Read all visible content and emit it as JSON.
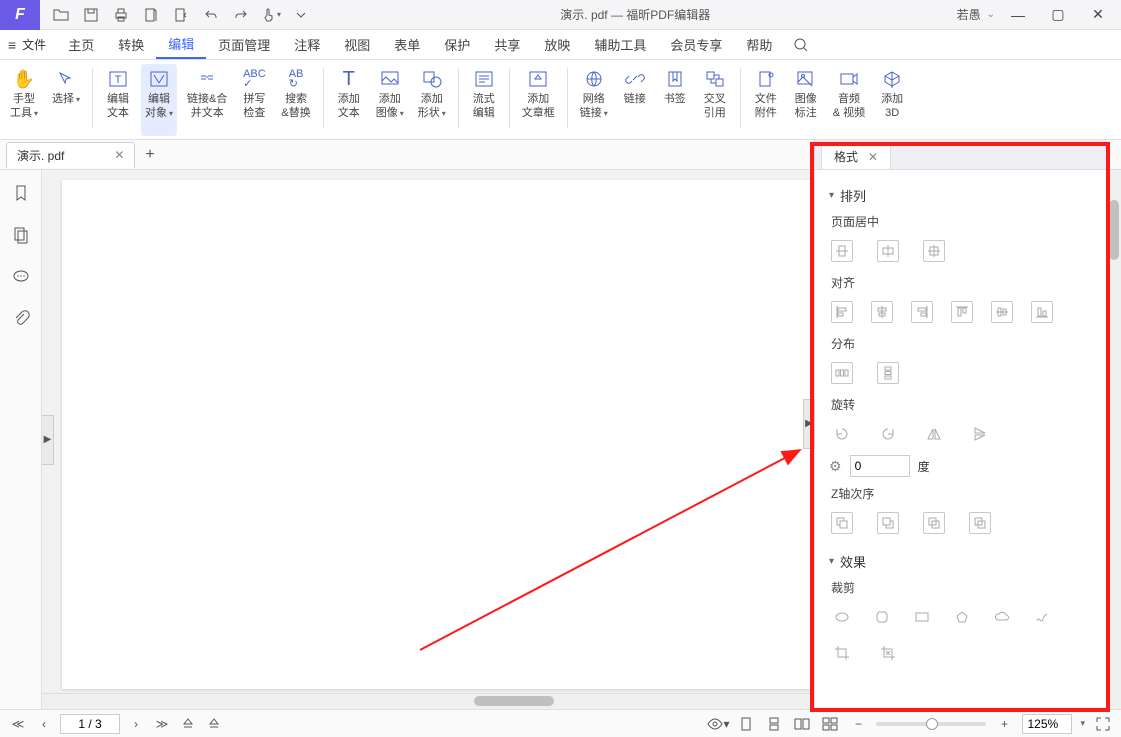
{
  "app": {
    "logo_letter": "F",
    "title": "演示. pdf — 福昕PDF编辑器",
    "user": "若愚"
  },
  "qat": [
    "open",
    "save",
    "print",
    "export-pdf",
    "export-word",
    "undo",
    "redo",
    "touch",
    "more"
  ],
  "menu": {
    "file": "文件",
    "items": [
      "主页",
      "转换",
      "编辑",
      "页面管理",
      "注释",
      "视图",
      "表单",
      "保护",
      "共享",
      "放映",
      "辅助工具",
      "会员专享",
      "帮助"
    ],
    "active": 2
  },
  "ribbon": {
    "groups": [
      {
        "id": "hand",
        "label": "手型\n工具",
        "dd": true
      },
      {
        "id": "select",
        "label": "选择",
        "dd": true
      },
      {
        "sep": true
      },
      {
        "id": "edit-text",
        "label": "编辑\n文本"
      },
      {
        "id": "edit-object",
        "label": "编辑\n对象",
        "dd": true,
        "active": true
      },
      {
        "id": "link-merge",
        "label": "链接&合\n并文本"
      },
      {
        "id": "spell",
        "label": "拼写\n检查"
      },
      {
        "id": "find-replace",
        "label": "搜索\n&替换"
      },
      {
        "sep": true
      },
      {
        "id": "add-text",
        "label": "添加\n文本"
      },
      {
        "id": "add-image",
        "label": "添加\n图像",
        "dd": true
      },
      {
        "id": "add-shape",
        "label": "添加\n形状",
        "dd": true
      },
      {
        "sep": true
      },
      {
        "id": "flow-edit",
        "label": "流式\n编辑"
      },
      {
        "sep": true
      },
      {
        "id": "add-article",
        "label": "添加\n文章框"
      },
      {
        "sep": true
      },
      {
        "id": "web-link",
        "label": "网络\n链接",
        "dd": true
      },
      {
        "id": "link",
        "label": "链接"
      },
      {
        "id": "bookmark",
        "label": "书签"
      },
      {
        "id": "crossref",
        "label": "交叉\n引用"
      },
      {
        "sep": true
      },
      {
        "id": "attachment",
        "label": "文件\n附件"
      },
      {
        "id": "image-mark",
        "label": "图像\n标注"
      },
      {
        "id": "audio-video",
        "label": "音频\n& 视频"
      },
      {
        "id": "add-3d",
        "label": "添加\n3D"
      }
    ]
  },
  "doctab": {
    "name": "演示. pdf"
  },
  "leftbar": [
    "bookmark",
    "pages",
    "comments",
    "attachments"
  ],
  "rightpanel": {
    "tab": "格式",
    "sections": {
      "arrange": {
        "title": "排列",
        "page_center": "页面居中",
        "align": "对齐",
        "distribute": "分布",
        "rotate": "旋转",
        "degree_value": "0",
        "degree_unit": "度",
        "zorder": "Z轴次序"
      },
      "effect": {
        "title": "效果",
        "crop": "裁剪"
      }
    }
  },
  "status": {
    "page": "1 / 3",
    "zoom": "125%"
  }
}
